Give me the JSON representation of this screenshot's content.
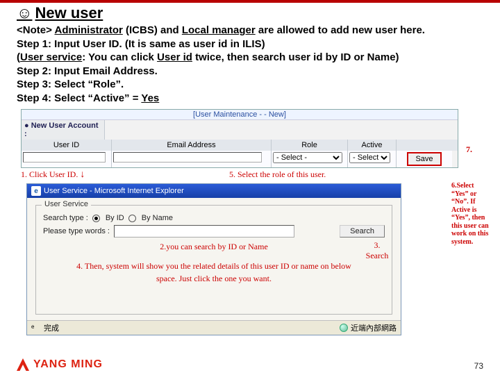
{
  "title": "New user",
  "note": {
    "line1a": "<Note>",
    "line1b": "Administrator",
    "line1c": " (ICBS) and ",
    "line1d": "Local manager",
    "line1e": " are allowed to add new user here.",
    "step1": "Step 1: Input User ID. (It is same as user id in ILIS)",
    "svc_a": "(",
    "svc_b": "User service",
    "svc_c": ": You can click ",
    "svc_d": "User id",
    "svc_e": " twice, then search user id by ID or Name)",
    "step2": "Step 2: Input Email Address.",
    "step3": "Step 3: Select “Role”.",
    "step4": "Step 4: Select “Active” = ",
    "step4yes": "Yes"
  },
  "um": {
    "caption": "[User Maintenance - - New]",
    "account_label": "New User Account :",
    "headers": {
      "id": "User ID",
      "email": "Email Address",
      "role": "Role",
      "active": "Active"
    },
    "role_value": "- Select -",
    "active_value": "- Select -",
    "save": "Save"
  },
  "anno": {
    "seven": "7.",
    "a1": "1. Click User ID.",
    "a5": "5. Select the role of this user.",
    "a2": "2.you can search by ID or Name",
    "a3": "3. Search",
    "a4": "4. Then, system will show you the related details of this user ID or name on below space. Just click the one you want.",
    "a6": "6.Select “Yes” or “No”. If Active is “Yes”, then this user can work on this system."
  },
  "ie": {
    "title": "User Service - Microsoft Internet Explorer",
    "legend": "User Service",
    "search_type_label": "Search type :",
    "by_id": "By ID",
    "by_name": "By Name",
    "please_type": "Please type words :",
    "search_btn": "Search",
    "status_done": "完成",
    "status_zone": "近端內部網路"
  },
  "footer": {
    "brand": "YANG MING",
    "page": "73"
  }
}
